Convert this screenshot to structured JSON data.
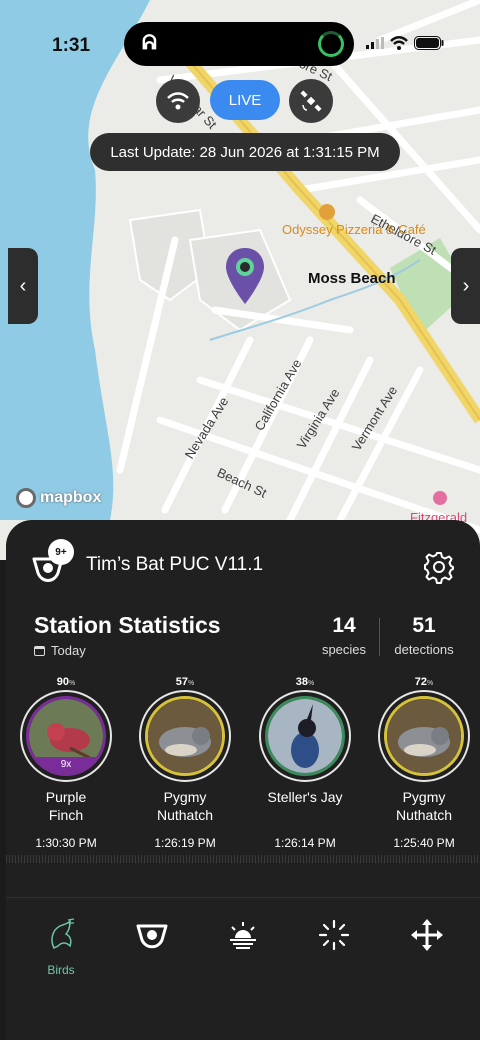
{
  "status_bar": {
    "time": "1:31"
  },
  "map": {
    "streets": [
      "Vallemar St",
      "Etheldore St",
      "Nevada Ave",
      "California Ave",
      "Virginia Ave",
      "Vermont Ave",
      "Beach St",
      "ore St"
    ],
    "places": {
      "town": "Moss Beach",
      "poi": "Odyssey Pizzeria & Café",
      "poi2": "Fitzgerald"
    },
    "attribution": "mapbox"
  },
  "live_controls": {
    "live_label": "LIVE",
    "last_update": "Last Update: 28 Jun 2026 at 1:31:15 PM"
  },
  "station": {
    "badge": "9+",
    "name": "Tim’s Bat PUC V11.1"
  },
  "stats": {
    "title": "Station Statistics",
    "period": "Today",
    "species_count": "14",
    "species_label": "species",
    "detections_count": "51",
    "detections_label": "detections"
  },
  "birds": [
    {
      "name_line1": "Purple",
      "name_line2": "Finch",
      "confidence": "90",
      "count": "9x",
      "time": "1:30:30 PM",
      "ring_color": "#7a2d9a"
    },
    {
      "name_line1": "Pygmy",
      "name_line2": "Nuthatch",
      "confidence": "57",
      "time": "1:26:19 PM",
      "ring_color": "#d6c23a"
    },
    {
      "name_line1": "Steller's Jay",
      "name_line2": "",
      "confidence": "38",
      "time": "1:26:14 PM",
      "ring_color": "#3a8c5a"
    },
    {
      "name_line1": "Pygmy",
      "name_line2": "Nuthatch",
      "confidence": "72",
      "time": "1:25:40 PM",
      "ring_color": "#d6c23a"
    }
  ],
  "percent_symbol": "%",
  "tabs": [
    {
      "icon": "bird-icon",
      "label": "Birds",
      "active": true
    },
    {
      "icon": "station-icon"
    },
    {
      "icon": "sunrise-icon"
    },
    {
      "icon": "loading-spinner-icon"
    },
    {
      "icon": "move-arrows-icon"
    }
  ]
}
